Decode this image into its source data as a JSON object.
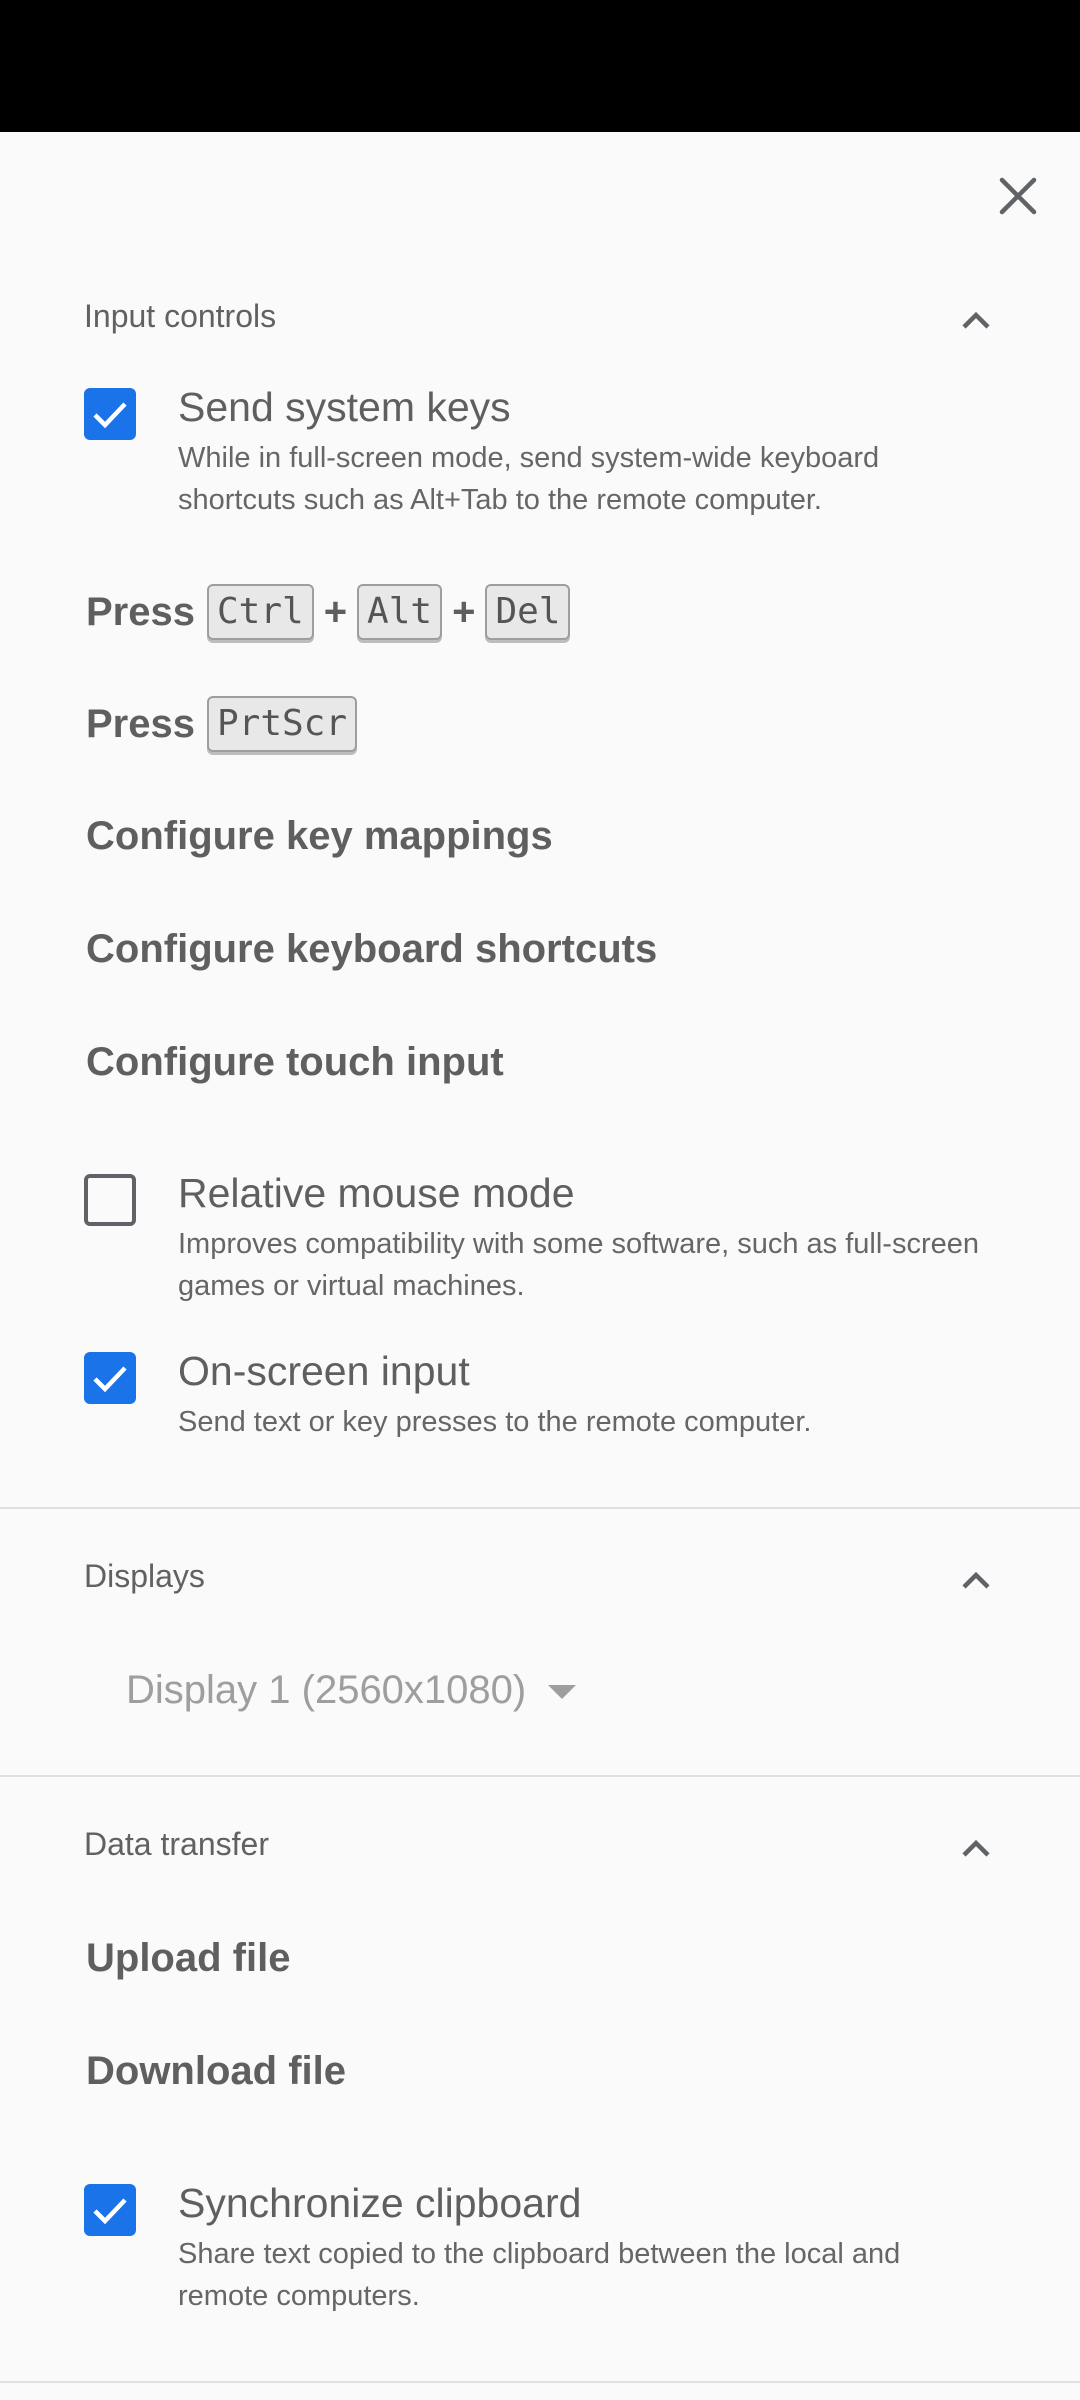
{
  "sections": {
    "input": {
      "title": "Input controls",
      "send_system_keys": {
        "title": "Send system keys",
        "desc": "While in full-screen mode, send system-wide keyboard shortcuts such as Alt+Tab to the remote computer.",
        "checked": true
      },
      "press_label": "Press",
      "plus": "+",
      "ctrl_alt_del": [
        "Ctrl",
        "Alt",
        "Del"
      ],
      "prtscr": "PrtScr",
      "configure_key_mappings": "Configure key mappings",
      "configure_keyboard_shortcuts": "Configure keyboard shortcuts",
      "configure_touch_input": "Configure touch input",
      "relative_mouse": {
        "title": "Relative mouse mode",
        "desc": "Improves compatibility with some software, such as full-screen games or virtual machines.",
        "checked": false
      },
      "onscreen_input": {
        "title": "On-screen input",
        "desc": "Send text or key presses to the remote computer.",
        "checked": true
      }
    },
    "displays": {
      "title": "Displays",
      "selected": "Display 1 (2560x1080)"
    },
    "data_transfer": {
      "title": "Data transfer",
      "upload": "Upload file",
      "download": "Download file",
      "sync_clipboard": {
        "title": "Synchronize clipboard",
        "desc": "Share text copied to the clipboard between the local and remote computers.",
        "checked": true
      }
    }
  },
  "icons": {
    "close": "close-icon",
    "chevron": "chevron-up-icon",
    "check": "check-icon",
    "dropdown": "dropdown-caret-icon"
  },
  "colors": {
    "accent": "#1a73e8",
    "background": "#fafafa",
    "text": "#5f5f5f"
  }
}
